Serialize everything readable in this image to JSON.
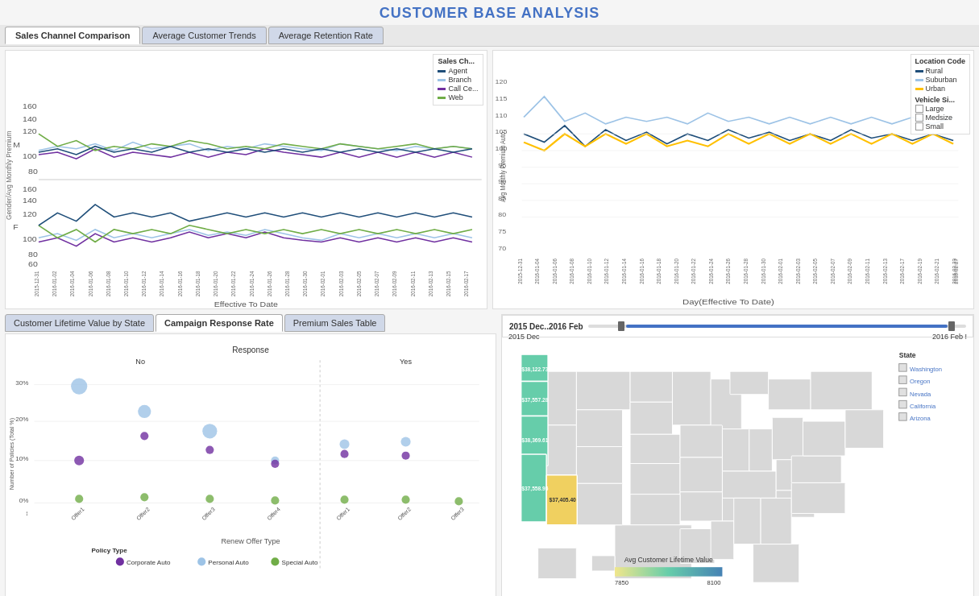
{
  "page": {
    "title": "CUSTOMER BASE ANALYSIS"
  },
  "top_tabs": {
    "items": [
      {
        "label": "Sales Channel Comparison",
        "active": true
      },
      {
        "label": "Average Customer Trends",
        "active": false
      },
      {
        "label": "Average Retention Rate",
        "active": false
      }
    ]
  },
  "left_chart": {
    "legend_title": "Sales Ch...",
    "legend_items": [
      {
        "label": "Agent",
        "color": "#1F4E79"
      },
      {
        "label": "Branch",
        "color": "#9DC3E6"
      },
      {
        "label": "Call Ce...",
        "color": "#7030A0"
      },
      {
        "label": "Web",
        "color": "#70AD47"
      }
    ],
    "x_axis_label": "Effective To Date",
    "y_labels": [
      "M",
      "F"
    ]
  },
  "right_chart": {
    "legend_title": "Location Code",
    "legend_items": [
      {
        "label": "Rural",
        "color": "#1F4E79"
      },
      {
        "label": "Suburban",
        "color": "#9DC3E6"
      },
      {
        "label": "Urban",
        "color": "#FFC000"
      }
    ],
    "vehicle_legend_title": "Vehicle Si...",
    "vehicle_items": [
      {
        "label": "Large"
      },
      {
        "label": "Medsize"
      },
      {
        "label": "Small"
      }
    ],
    "x_axis_label": "Day(Effective To Date)",
    "y_axis_label": "Avg Monthly Premium Auto"
  },
  "bottom_tabs": {
    "items": [
      {
        "label": "Customer Lifetime Value by State",
        "active": false
      },
      {
        "label": "Campaign Response Rate",
        "active": true
      },
      {
        "label": "Premium Sales Table",
        "active": false
      }
    ]
  },
  "slider": {
    "title": "2015 Dec..2016 Feb",
    "left_label": "2015 Dec",
    "right_label": "2016 Feb !"
  },
  "scatter": {
    "title": "Response",
    "col_no": "No",
    "col_yes": "Yes",
    "x_axis_label": "Renew Offer Type",
    "y_axis_label": "Number of Policies (Total %)",
    "y_ticks": [
      "30%",
      "20%",
      "10%",
      "0%"
    ],
    "x_offers_no": [
      "Offer1",
      "Offer2",
      "Offer3",
      "Offer4"
    ],
    "x_offers_yes": [
      "Offer1",
      "Offer2",
      "Offer3"
    ],
    "policy_legend_title": "Policy Type",
    "policy_items": [
      {
        "label": "Corporate Auto",
        "color": "#7030A0"
      },
      {
        "label": "Personal Auto",
        "color": "#9DC3E6"
      },
      {
        "label": "Special Auto",
        "color": "#70AD47"
      }
    ]
  },
  "map": {
    "values": [
      {
        "state": "Washington",
        "label": "$38,122.73",
        "color": "#4682b4"
      },
      {
        "state": "Oregon",
        "label": "$37,557.28",
        "color": "#66cdaa"
      },
      {
        "state": "Nevada",
        "label": "$38,369.61",
        "color": "#66cdaa"
      },
      {
        "state": "California",
        "label": "$37,558.95",
        "color": "#66cdaa"
      },
      {
        "state": "Arizona",
        "label": "$37,405.40",
        "color": "#f0e68c"
      }
    ],
    "legend_title": "State",
    "color_scale_label": "Avg Customer Lifetime Value",
    "scale_min": "7850",
    "scale_max": "8100"
  }
}
